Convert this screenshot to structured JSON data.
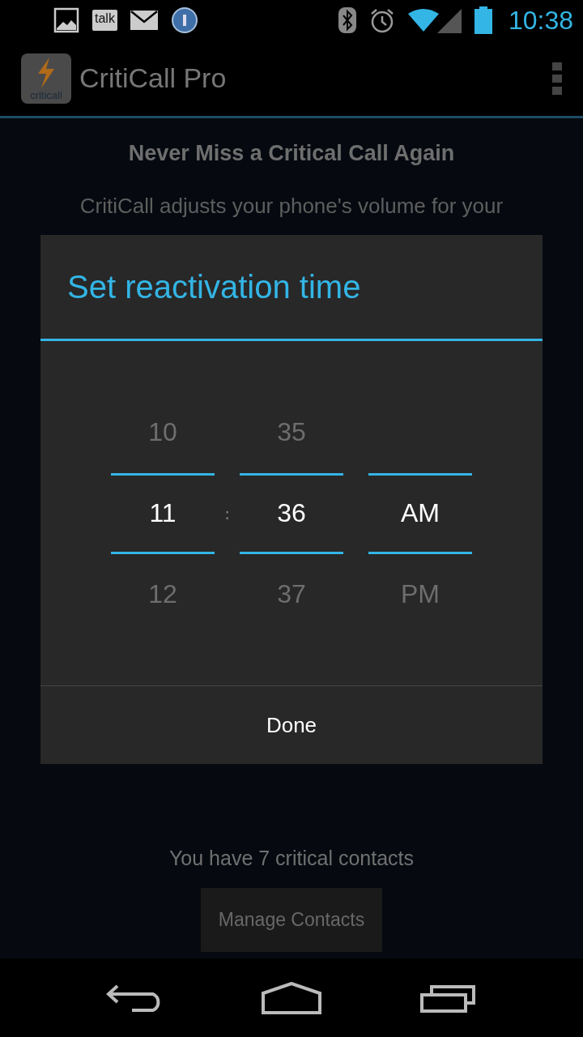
{
  "status_bar": {
    "chat_label": "talk",
    "time": "10:38"
  },
  "app_bar": {
    "logo_text": "criticall",
    "title": "CritiCall Pro"
  },
  "content": {
    "heading": "Never Miss a Critical Call Again",
    "body": "CritiCall adjusts your phone's volume for your"
  },
  "dialog": {
    "title": "Set reactivation time",
    "pickers": [
      {
        "previous": "10",
        "current": "11",
        "next": "12"
      },
      {
        "previous": "35",
        "current": "36",
        "next": "37"
      },
      {
        "current": "AM",
        "next": "PM"
      }
    ],
    "separator": ":",
    "button": "Done"
  },
  "footer": {
    "contacts_text": "You have 7 critical contacts",
    "button": "Manage Contacts"
  }
}
